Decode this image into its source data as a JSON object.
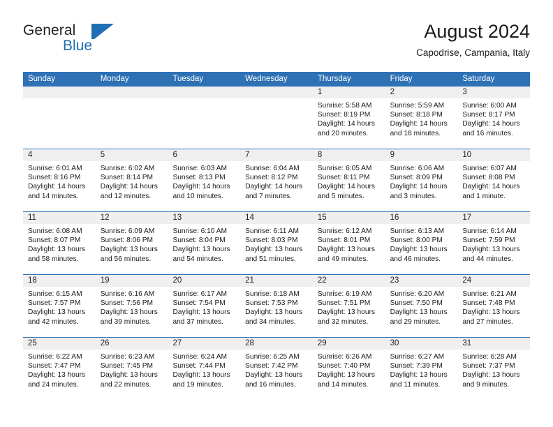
{
  "logo": {
    "word1": "General",
    "word2": "Blue",
    "mark": "triangle-flag-icon",
    "brand_color": "#1f6fb5"
  },
  "header": {
    "title": "August 2024",
    "subtitle": "Capodrise, Campania, Italy"
  },
  "colors": {
    "header_blue": "#2e71b5",
    "daynum_band": "#efefef",
    "text": "#1a1a1a"
  },
  "calendar": {
    "weekday_headers": [
      "Sunday",
      "Monday",
      "Tuesday",
      "Wednesday",
      "Thursday",
      "Friday",
      "Saturday"
    ],
    "weeks": [
      [
        {
          "day": "",
          "lines": []
        },
        {
          "day": "",
          "lines": []
        },
        {
          "day": "",
          "lines": []
        },
        {
          "day": "",
          "lines": []
        },
        {
          "day": "1",
          "lines": [
            "Sunrise: 5:58 AM",
            "Sunset: 8:19 PM",
            "Daylight: 14 hours",
            "and 20 minutes."
          ]
        },
        {
          "day": "2",
          "lines": [
            "Sunrise: 5:59 AM",
            "Sunset: 8:18 PM",
            "Daylight: 14 hours",
            "and 18 minutes."
          ]
        },
        {
          "day": "3",
          "lines": [
            "Sunrise: 6:00 AM",
            "Sunset: 8:17 PM",
            "Daylight: 14 hours",
            "and 16 minutes."
          ]
        }
      ],
      [
        {
          "day": "4",
          "lines": [
            "Sunrise: 6:01 AM",
            "Sunset: 8:16 PM",
            "Daylight: 14 hours",
            "and 14 minutes."
          ]
        },
        {
          "day": "5",
          "lines": [
            "Sunrise: 6:02 AM",
            "Sunset: 8:14 PM",
            "Daylight: 14 hours",
            "and 12 minutes."
          ]
        },
        {
          "day": "6",
          "lines": [
            "Sunrise: 6:03 AM",
            "Sunset: 8:13 PM",
            "Daylight: 14 hours",
            "and 10 minutes."
          ]
        },
        {
          "day": "7",
          "lines": [
            "Sunrise: 6:04 AM",
            "Sunset: 8:12 PM",
            "Daylight: 14 hours",
            "and 7 minutes."
          ]
        },
        {
          "day": "8",
          "lines": [
            "Sunrise: 6:05 AM",
            "Sunset: 8:11 PM",
            "Daylight: 14 hours",
            "and 5 minutes."
          ]
        },
        {
          "day": "9",
          "lines": [
            "Sunrise: 6:06 AM",
            "Sunset: 8:09 PM",
            "Daylight: 14 hours",
            "and 3 minutes."
          ]
        },
        {
          "day": "10",
          "lines": [
            "Sunrise: 6:07 AM",
            "Sunset: 8:08 PM",
            "Daylight: 14 hours",
            "and 1 minute."
          ]
        }
      ],
      [
        {
          "day": "11",
          "lines": [
            "Sunrise: 6:08 AM",
            "Sunset: 8:07 PM",
            "Daylight: 13 hours",
            "and 58 minutes."
          ]
        },
        {
          "day": "12",
          "lines": [
            "Sunrise: 6:09 AM",
            "Sunset: 8:06 PM",
            "Daylight: 13 hours",
            "and 56 minutes."
          ]
        },
        {
          "day": "13",
          "lines": [
            "Sunrise: 6:10 AM",
            "Sunset: 8:04 PM",
            "Daylight: 13 hours",
            "and 54 minutes."
          ]
        },
        {
          "day": "14",
          "lines": [
            "Sunrise: 6:11 AM",
            "Sunset: 8:03 PM",
            "Daylight: 13 hours",
            "and 51 minutes."
          ]
        },
        {
          "day": "15",
          "lines": [
            "Sunrise: 6:12 AM",
            "Sunset: 8:01 PM",
            "Daylight: 13 hours",
            "and 49 minutes."
          ]
        },
        {
          "day": "16",
          "lines": [
            "Sunrise: 6:13 AM",
            "Sunset: 8:00 PM",
            "Daylight: 13 hours",
            "and 46 minutes."
          ]
        },
        {
          "day": "17",
          "lines": [
            "Sunrise: 6:14 AM",
            "Sunset: 7:59 PM",
            "Daylight: 13 hours",
            "and 44 minutes."
          ]
        }
      ],
      [
        {
          "day": "18",
          "lines": [
            "Sunrise: 6:15 AM",
            "Sunset: 7:57 PM",
            "Daylight: 13 hours",
            "and 42 minutes."
          ]
        },
        {
          "day": "19",
          "lines": [
            "Sunrise: 6:16 AM",
            "Sunset: 7:56 PM",
            "Daylight: 13 hours",
            "and 39 minutes."
          ]
        },
        {
          "day": "20",
          "lines": [
            "Sunrise: 6:17 AM",
            "Sunset: 7:54 PM",
            "Daylight: 13 hours",
            "and 37 minutes."
          ]
        },
        {
          "day": "21",
          "lines": [
            "Sunrise: 6:18 AM",
            "Sunset: 7:53 PM",
            "Daylight: 13 hours",
            "and 34 minutes."
          ]
        },
        {
          "day": "22",
          "lines": [
            "Sunrise: 6:19 AM",
            "Sunset: 7:51 PM",
            "Daylight: 13 hours",
            "and 32 minutes."
          ]
        },
        {
          "day": "23",
          "lines": [
            "Sunrise: 6:20 AM",
            "Sunset: 7:50 PM",
            "Daylight: 13 hours",
            "and 29 minutes."
          ]
        },
        {
          "day": "24",
          "lines": [
            "Sunrise: 6:21 AM",
            "Sunset: 7:48 PM",
            "Daylight: 13 hours",
            "and 27 minutes."
          ]
        }
      ],
      [
        {
          "day": "25",
          "lines": [
            "Sunrise: 6:22 AM",
            "Sunset: 7:47 PM",
            "Daylight: 13 hours",
            "and 24 minutes."
          ]
        },
        {
          "day": "26",
          "lines": [
            "Sunrise: 6:23 AM",
            "Sunset: 7:45 PM",
            "Daylight: 13 hours",
            "and 22 minutes."
          ]
        },
        {
          "day": "27",
          "lines": [
            "Sunrise: 6:24 AM",
            "Sunset: 7:44 PM",
            "Daylight: 13 hours",
            "and 19 minutes."
          ]
        },
        {
          "day": "28",
          "lines": [
            "Sunrise: 6:25 AM",
            "Sunset: 7:42 PM",
            "Daylight: 13 hours",
            "and 16 minutes."
          ]
        },
        {
          "day": "29",
          "lines": [
            "Sunrise: 6:26 AM",
            "Sunset: 7:40 PM",
            "Daylight: 13 hours",
            "and 14 minutes."
          ]
        },
        {
          "day": "30",
          "lines": [
            "Sunrise: 6:27 AM",
            "Sunset: 7:39 PM",
            "Daylight: 13 hours",
            "and 11 minutes."
          ]
        },
        {
          "day": "31",
          "lines": [
            "Sunrise: 6:28 AM",
            "Sunset: 7:37 PM",
            "Daylight: 13 hours",
            "and 9 minutes."
          ]
        }
      ]
    ]
  }
}
